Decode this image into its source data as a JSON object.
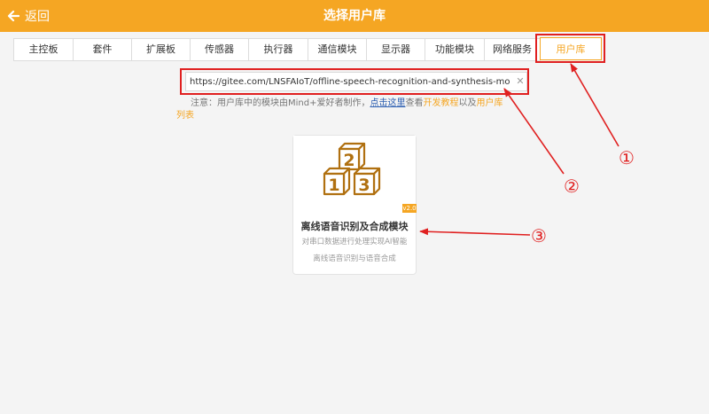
{
  "header": {
    "back_label": "返回",
    "title": "选择用户库",
    "bg_color": "#f5a623"
  },
  "tabs": [
    {
      "label": "主控板"
    },
    {
      "label": "套件"
    },
    {
      "label": "扩展板"
    },
    {
      "label": "传感器"
    },
    {
      "label": "执行器"
    },
    {
      "label": "通信模块"
    },
    {
      "label": "显示器"
    },
    {
      "label": "功能模块"
    },
    {
      "label": "网络服务"
    }
  ],
  "active_tab": {
    "label": "用户库"
  },
  "search": {
    "value": "https://gitee.com/LNSFAIoT/offline-speech-recognition-and-synthesis-modules"
  },
  "notice": {
    "prefix": "注意：用户库中的模块由Mind+爱好者制作，",
    "link": "点击这里",
    "mid1": "查看",
    "tutorial": "开发教程",
    "mid2": "以及",
    "list_part1": "用户库",
    "list_part2": "列表"
  },
  "card": {
    "title": "离线语音识别及合成模块",
    "description": "对串口数据进行处理实现AI智能",
    "subtitle": "离线语音识别与语音合成",
    "version": "v2.0",
    "blocks": [
      "1",
      "2",
      "3"
    ]
  },
  "annotations": [
    "①",
    "②",
    "③"
  ],
  "colors": {
    "accent": "#f5a623",
    "annotation": "#e02020",
    "link": "#2a5db0"
  }
}
